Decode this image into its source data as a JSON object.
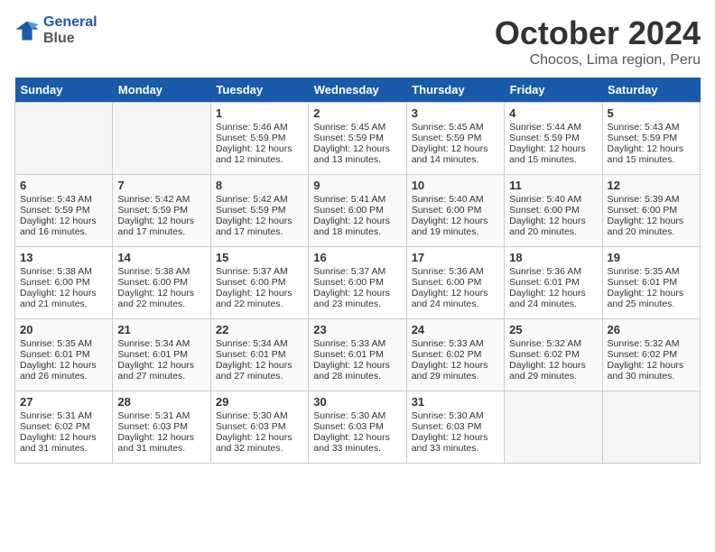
{
  "header": {
    "logo_line1": "General",
    "logo_line2": "Blue",
    "month": "October 2024",
    "location": "Chocos, Lima region, Peru"
  },
  "days_of_week": [
    "Sunday",
    "Monday",
    "Tuesday",
    "Wednesday",
    "Thursday",
    "Friday",
    "Saturday"
  ],
  "weeks": [
    [
      {
        "day": "",
        "empty": true
      },
      {
        "day": "",
        "empty": true
      },
      {
        "day": "1",
        "sunrise": "5:46 AM",
        "sunset": "5:59 PM",
        "daylight": "12 hours and 12 minutes."
      },
      {
        "day": "2",
        "sunrise": "5:45 AM",
        "sunset": "5:59 PM",
        "daylight": "12 hours and 13 minutes."
      },
      {
        "day": "3",
        "sunrise": "5:45 AM",
        "sunset": "5:59 PM",
        "daylight": "12 hours and 14 minutes."
      },
      {
        "day": "4",
        "sunrise": "5:44 AM",
        "sunset": "5:59 PM",
        "daylight": "12 hours and 15 minutes."
      },
      {
        "day": "5",
        "sunrise": "5:43 AM",
        "sunset": "5:59 PM",
        "daylight": "12 hours and 15 minutes."
      }
    ],
    [
      {
        "day": "6",
        "sunrise": "5:43 AM",
        "sunset": "5:59 PM",
        "daylight": "12 hours and 16 minutes."
      },
      {
        "day": "7",
        "sunrise": "5:42 AM",
        "sunset": "5:59 PM",
        "daylight": "12 hours and 17 minutes."
      },
      {
        "day": "8",
        "sunrise": "5:42 AM",
        "sunset": "5:59 PM",
        "daylight": "12 hours and 17 minutes."
      },
      {
        "day": "9",
        "sunrise": "5:41 AM",
        "sunset": "6:00 PM",
        "daylight": "12 hours and 18 minutes."
      },
      {
        "day": "10",
        "sunrise": "5:40 AM",
        "sunset": "6:00 PM",
        "daylight": "12 hours and 19 minutes."
      },
      {
        "day": "11",
        "sunrise": "5:40 AM",
        "sunset": "6:00 PM",
        "daylight": "12 hours and 20 minutes."
      },
      {
        "day": "12",
        "sunrise": "5:39 AM",
        "sunset": "6:00 PM",
        "daylight": "12 hours and 20 minutes."
      }
    ],
    [
      {
        "day": "13",
        "sunrise": "5:38 AM",
        "sunset": "6:00 PM",
        "daylight": "12 hours and 21 minutes."
      },
      {
        "day": "14",
        "sunrise": "5:38 AM",
        "sunset": "6:00 PM",
        "daylight": "12 hours and 22 minutes."
      },
      {
        "day": "15",
        "sunrise": "5:37 AM",
        "sunset": "6:00 PM",
        "daylight": "12 hours and 22 minutes."
      },
      {
        "day": "16",
        "sunrise": "5:37 AM",
        "sunset": "6:00 PM",
        "daylight": "12 hours and 23 minutes."
      },
      {
        "day": "17",
        "sunrise": "5:36 AM",
        "sunset": "6:00 PM",
        "daylight": "12 hours and 24 minutes."
      },
      {
        "day": "18",
        "sunrise": "5:36 AM",
        "sunset": "6:01 PM",
        "daylight": "12 hours and 24 minutes."
      },
      {
        "day": "19",
        "sunrise": "5:35 AM",
        "sunset": "6:01 PM",
        "daylight": "12 hours and 25 minutes."
      }
    ],
    [
      {
        "day": "20",
        "sunrise": "5:35 AM",
        "sunset": "6:01 PM",
        "daylight": "12 hours and 26 minutes."
      },
      {
        "day": "21",
        "sunrise": "5:34 AM",
        "sunset": "6:01 PM",
        "daylight": "12 hours and 27 minutes."
      },
      {
        "day": "22",
        "sunrise": "5:34 AM",
        "sunset": "6:01 PM",
        "daylight": "12 hours and 27 minutes."
      },
      {
        "day": "23",
        "sunrise": "5:33 AM",
        "sunset": "6:01 PM",
        "daylight": "12 hours and 28 minutes."
      },
      {
        "day": "24",
        "sunrise": "5:33 AM",
        "sunset": "6:02 PM",
        "daylight": "12 hours and 29 minutes."
      },
      {
        "day": "25",
        "sunrise": "5:32 AM",
        "sunset": "6:02 PM",
        "daylight": "12 hours and 29 minutes."
      },
      {
        "day": "26",
        "sunrise": "5:32 AM",
        "sunset": "6:02 PM",
        "daylight": "12 hours and 30 minutes."
      }
    ],
    [
      {
        "day": "27",
        "sunrise": "5:31 AM",
        "sunset": "6:02 PM",
        "daylight": "12 hours and 31 minutes."
      },
      {
        "day": "28",
        "sunrise": "5:31 AM",
        "sunset": "6:03 PM",
        "daylight": "12 hours and 31 minutes."
      },
      {
        "day": "29",
        "sunrise": "5:30 AM",
        "sunset": "6:03 PM",
        "daylight": "12 hours and 32 minutes."
      },
      {
        "day": "30",
        "sunrise": "5:30 AM",
        "sunset": "6:03 PM",
        "daylight": "12 hours and 33 minutes."
      },
      {
        "day": "31",
        "sunrise": "5:30 AM",
        "sunset": "6:03 PM",
        "daylight": "12 hours and 33 minutes."
      },
      {
        "day": "",
        "empty": true
      },
      {
        "day": "",
        "empty": true
      }
    ]
  ]
}
